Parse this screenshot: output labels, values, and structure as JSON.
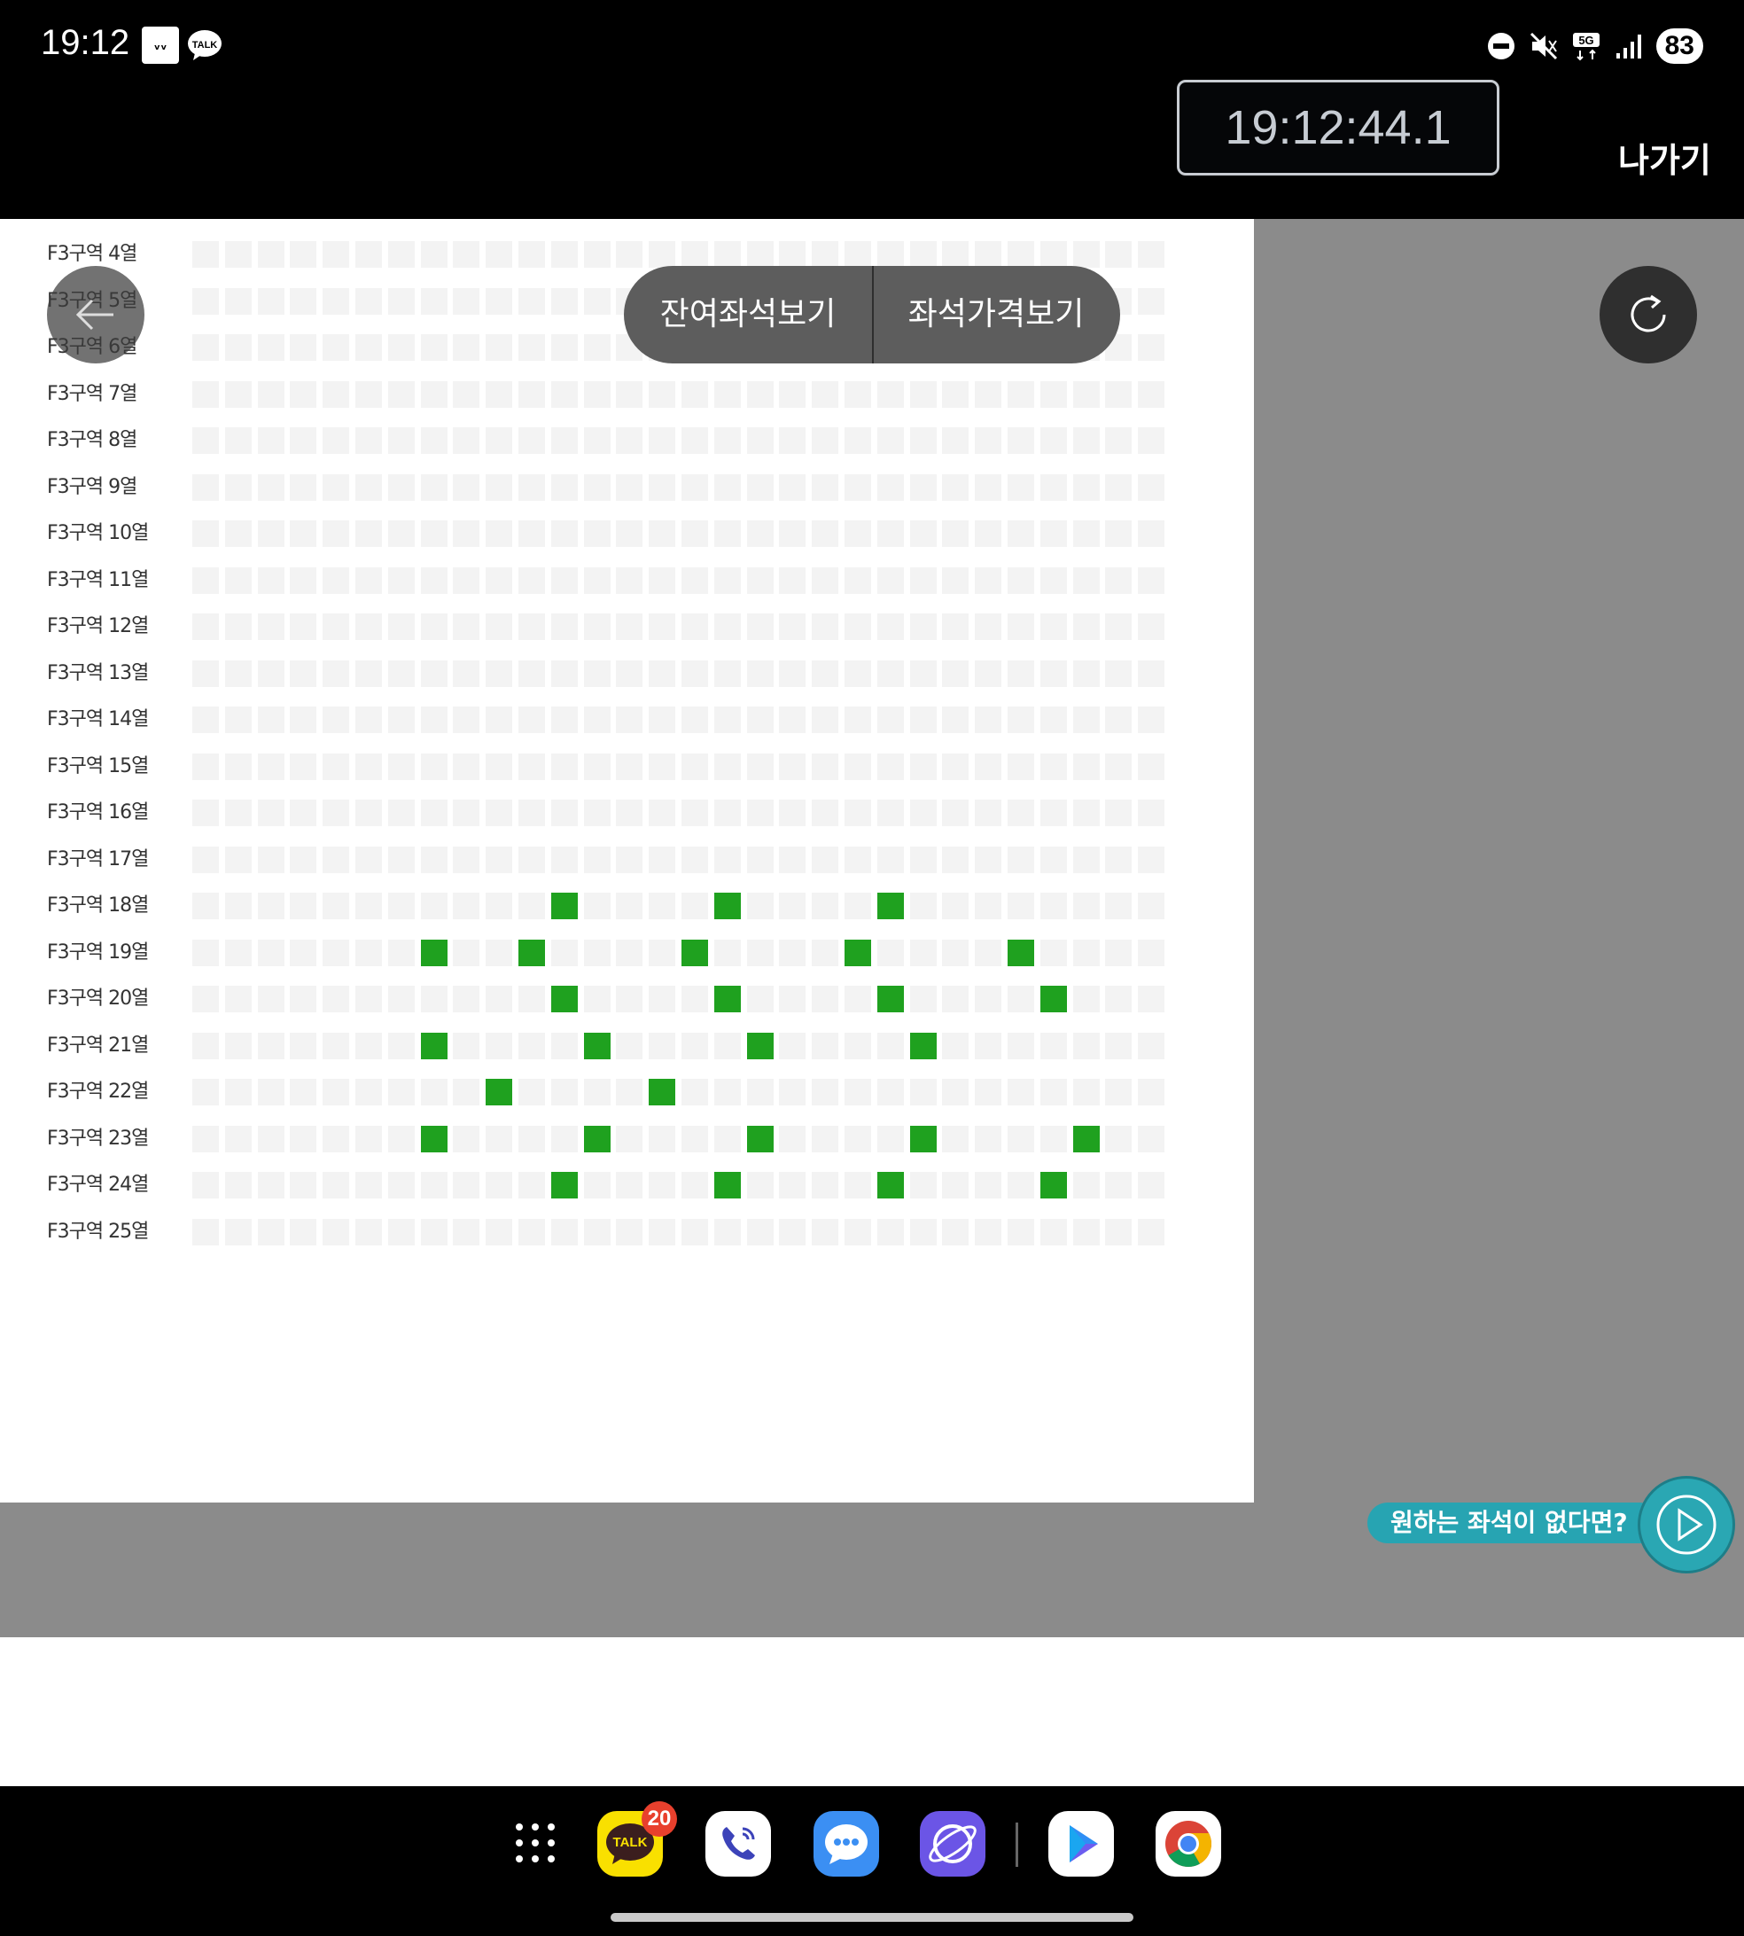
{
  "status_bar": {
    "time": "19:12",
    "icons": [
      "news-app-icon",
      "talk-app-icon",
      "dnd-icon",
      "mute-icon",
      "5g-icon",
      "signal-icon"
    ],
    "app_icon_talk_text": "TALK",
    "battery": "83"
  },
  "header": {
    "timer": "19:12:44.1",
    "exit_label": "나가기"
  },
  "toolbar": {
    "remaining_seats_label": "잔여좌석보기",
    "seat_price_label": "좌석가격보기"
  },
  "seat_map": {
    "seats_per_row": 30,
    "colors": {
      "empty": "#f3f3f3",
      "available": "#1fa11f"
    },
    "rows": [
      {
        "label": "F3구역 4열",
        "available": []
      },
      {
        "label": "F3구역 5열",
        "available": []
      },
      {
        "label": "F3구역 6열",
        "available": []
      },
      {
        "label": "F3구역 7열",
        "available": []
      },
      {
        "label": "F3구역 8열",
        "available": []
      },
      {
        "label": "F3구역 9열",
        "available": []
      },
      {
        "label": "F3구역 10열",
        "available": []
      },
      {
        "label": "F3구역 11열",
        "available": []
      },
      {
        "label": "F3구역 12열",
        "available": []
      },
      {
        "label": "F3구역 13열",
        "available": []
      },
      {
        "label": "F3구역 14열",
        "available": []
      },
      {
        "label": "F3구역 15열",
        "available": []
      },
      {
        "label": "F3구역 16열",
        "available": []
      },
      {
        "label": "F3구역 17열",
        "available": []
      },
      {
        "label": "F3구역 18열",
        "available": [
          11,
          16,
          21
        ]
      },
      {
        "label": "F3구역 19열",
        "available": [
          7,
          10,
          15,
          20,
          25
        ]
      },
      {
        "label": "F3구역 20열",
        "available": [
          11,
          16,
          21,
          26
        ]
      },
      {
        "label": "F3구역 21열",
        "available": [
          7,
          12,
          17,
          22
        ]
      },
      {
        "label": "F3구역 22열",
        "available": [
          9,
          14
        ]
      },
      {
        "label": "F3구역 23열",
        "available": [
          7,
          12,
          17,
          22,
          27
        ]
      },
      {
        "label": "F3구역 24열",
        "available": [
          11,
          16,
          21,
          26
        ]
      },
      {
        "label": "F3구역 25열",
        "available": []
      }
    ]
  },
  "banner": {
    "wish_label": "원하는 좌석이 없다면?"
  },
  "dock": {
    "apps": [
      "app-drawer-icon",
      "kakaotalk-app",
      "phone-app",
      "messages-app",
      "internet-app",
      "play-store-app",
      "chrome-app"
    ],
    "kakaotalk_text": "TALK",
    "kakaotalk_badge": "20"
  }
}
